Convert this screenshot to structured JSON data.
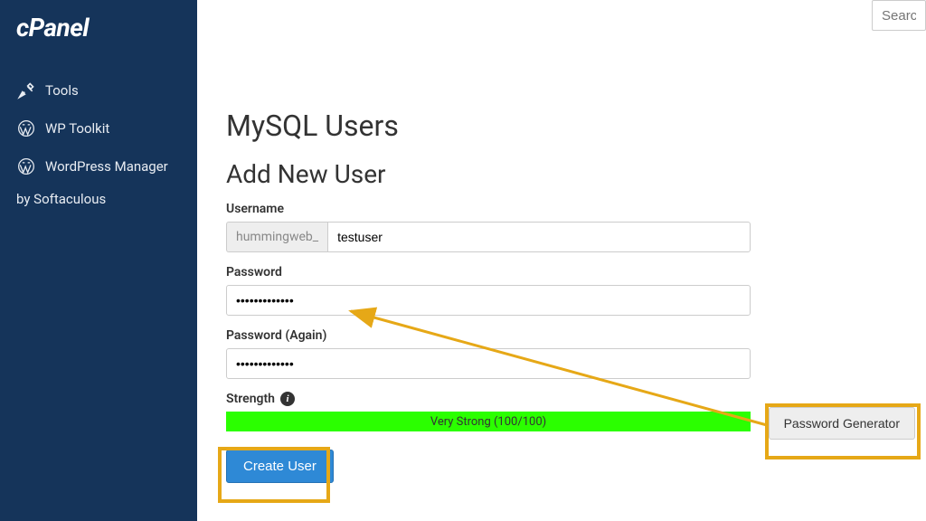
{
  "logo": "cPanel",
  "search_placeholder": "Search",
  "sidebar": {
    "items": [
      {
        "label": "Tools"
      },
      {
        "label": "WP Toolkit"
      },
      {
        "label": "WordPress Manager"
      }
    ],
    "sub": "by Softaculous"
  },
  "page": {
    "title": "MySQL Users",
    "section": "Add New User",
    "username_label": "Username",
    "username_prefix": "hummingweb_",
    "username_value": "testuser",
    "password_label": "Password",
    "password_value": "•••••••••••••",
    "password_again_label": "Password (Again)",
    "password_again_value": "•••••••••••••",
    "strength_label": "Strength",
    "strength_text": "Very Strong (100/100)",
    "create_btn": "Create User",
    "pw_gen_btn": "Password Generator"
  }
}
